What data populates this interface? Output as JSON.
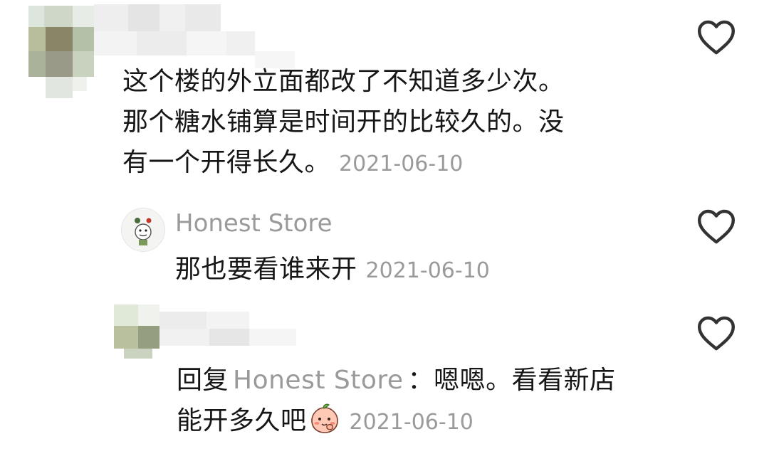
{
  "comments": [
    {
      "text_lines": [
        "这个楼的外立面都改了不知道多少次。",
        "那个糖水铺算是时间开的比较久的。没",
        "有一个开得长久。"
      ],
      "date": "2021-06-10"
    },
    {
      "username": "Honest Store",
      "text": "那也要看谁来开",
      "date": "2021-06-10"
    },
    {
      "reply_prefix": "回复",
      "reply_to": "Honest Store",
      "reply_colon": "：",
      "text_line1": "嗯嗯。看看新店",
      "text_line2": "能开多久吧",
      "date": "2021-06-10",
      "emoji": "peach-emoji"
    }
  ],
  "icons": {
    "like": "heart-outline-icon"
  },
  "colors": {
    "text": "#161616",
    "meta": "#9a9a9a",
    "heart": "#333333"
  }
}
